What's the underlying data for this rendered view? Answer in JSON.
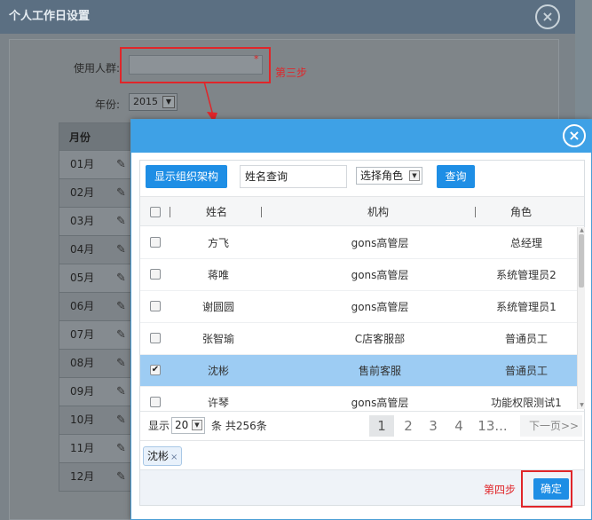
{
  "background_dialog": {
    "title": "个人工作日设置",
    "user_group_label": "使用人群:",
    "required_mark": "*",
    "step3": "第三步",
    "year_label": "年份:",
    "year_value": "2015",
    "months_header": "月份",
    "months": [
      "01月",
      "02月",
      "03月",
      "04月",
      "05月",
      "06月",
      "07月",
      "08月",
      "09月",
      "10月",
      "11月",
      "12月"
    ]
  },
  "modal": {
    "close_icon": "close-circle-icon",
    "toolbar": {
      "org_button": "显示组织架构",
      "name_search_value": "姓名查询",
      "role_select": "选择角色",
      "search_button": "查询"
    },
    "grid": {
      "headers": {
        "name": "姓名",
        "org": "机构",
        "role": "角色"
      },
      "rows": [
        {
          "name": "方飞",
          "org": "gons高管层",
          "role": "总经理",
          "checked": false
        },
        {
          "name": "蒋唯",
          "org": "gons高管层",
          "role": "系统管理员2",
          "checked": false
        },
        {
          "name": "谢圆圆",
          "org": "gons高管层",
          "role": "系统管理员1",
          "checked": false
        },
        {
          "name": "张智瑜",
          "org": "C店客服部",
          "role": "普通员工",
          "checked": false
        },
        {
          "name": "沈彬",
          "org": "售前客服",
          "role": "普通员工",
          "checked": true
        },
        {
          "name": "许琴",
          "org": "gons高管层",
          "role": "功能权限测试1",
          "checked": false
        }
      ]
    },
    "pager": {
      "show_label": "显示",
      "page_size": "20",
      "total_text": "条 共256条",
      "pages": [
        "1",
        "2",
        "3",
        "4",
        "13..."
      ],
      "current_page": "1",
      "next": "下一页>>"
    },
    "selected": {
      "tag": "沈彬",
      "remove": "×"
    },
    "footer": {
      "step4": "第四步",
      "ok_button": "确定"
    }
  },
  "colors": {
    "accent": "#3ea1e6",
    "button": "#1e8ee5",
    "highlight": "#e0262a",
    "selected_row": "#9dccf3"
  }
}
